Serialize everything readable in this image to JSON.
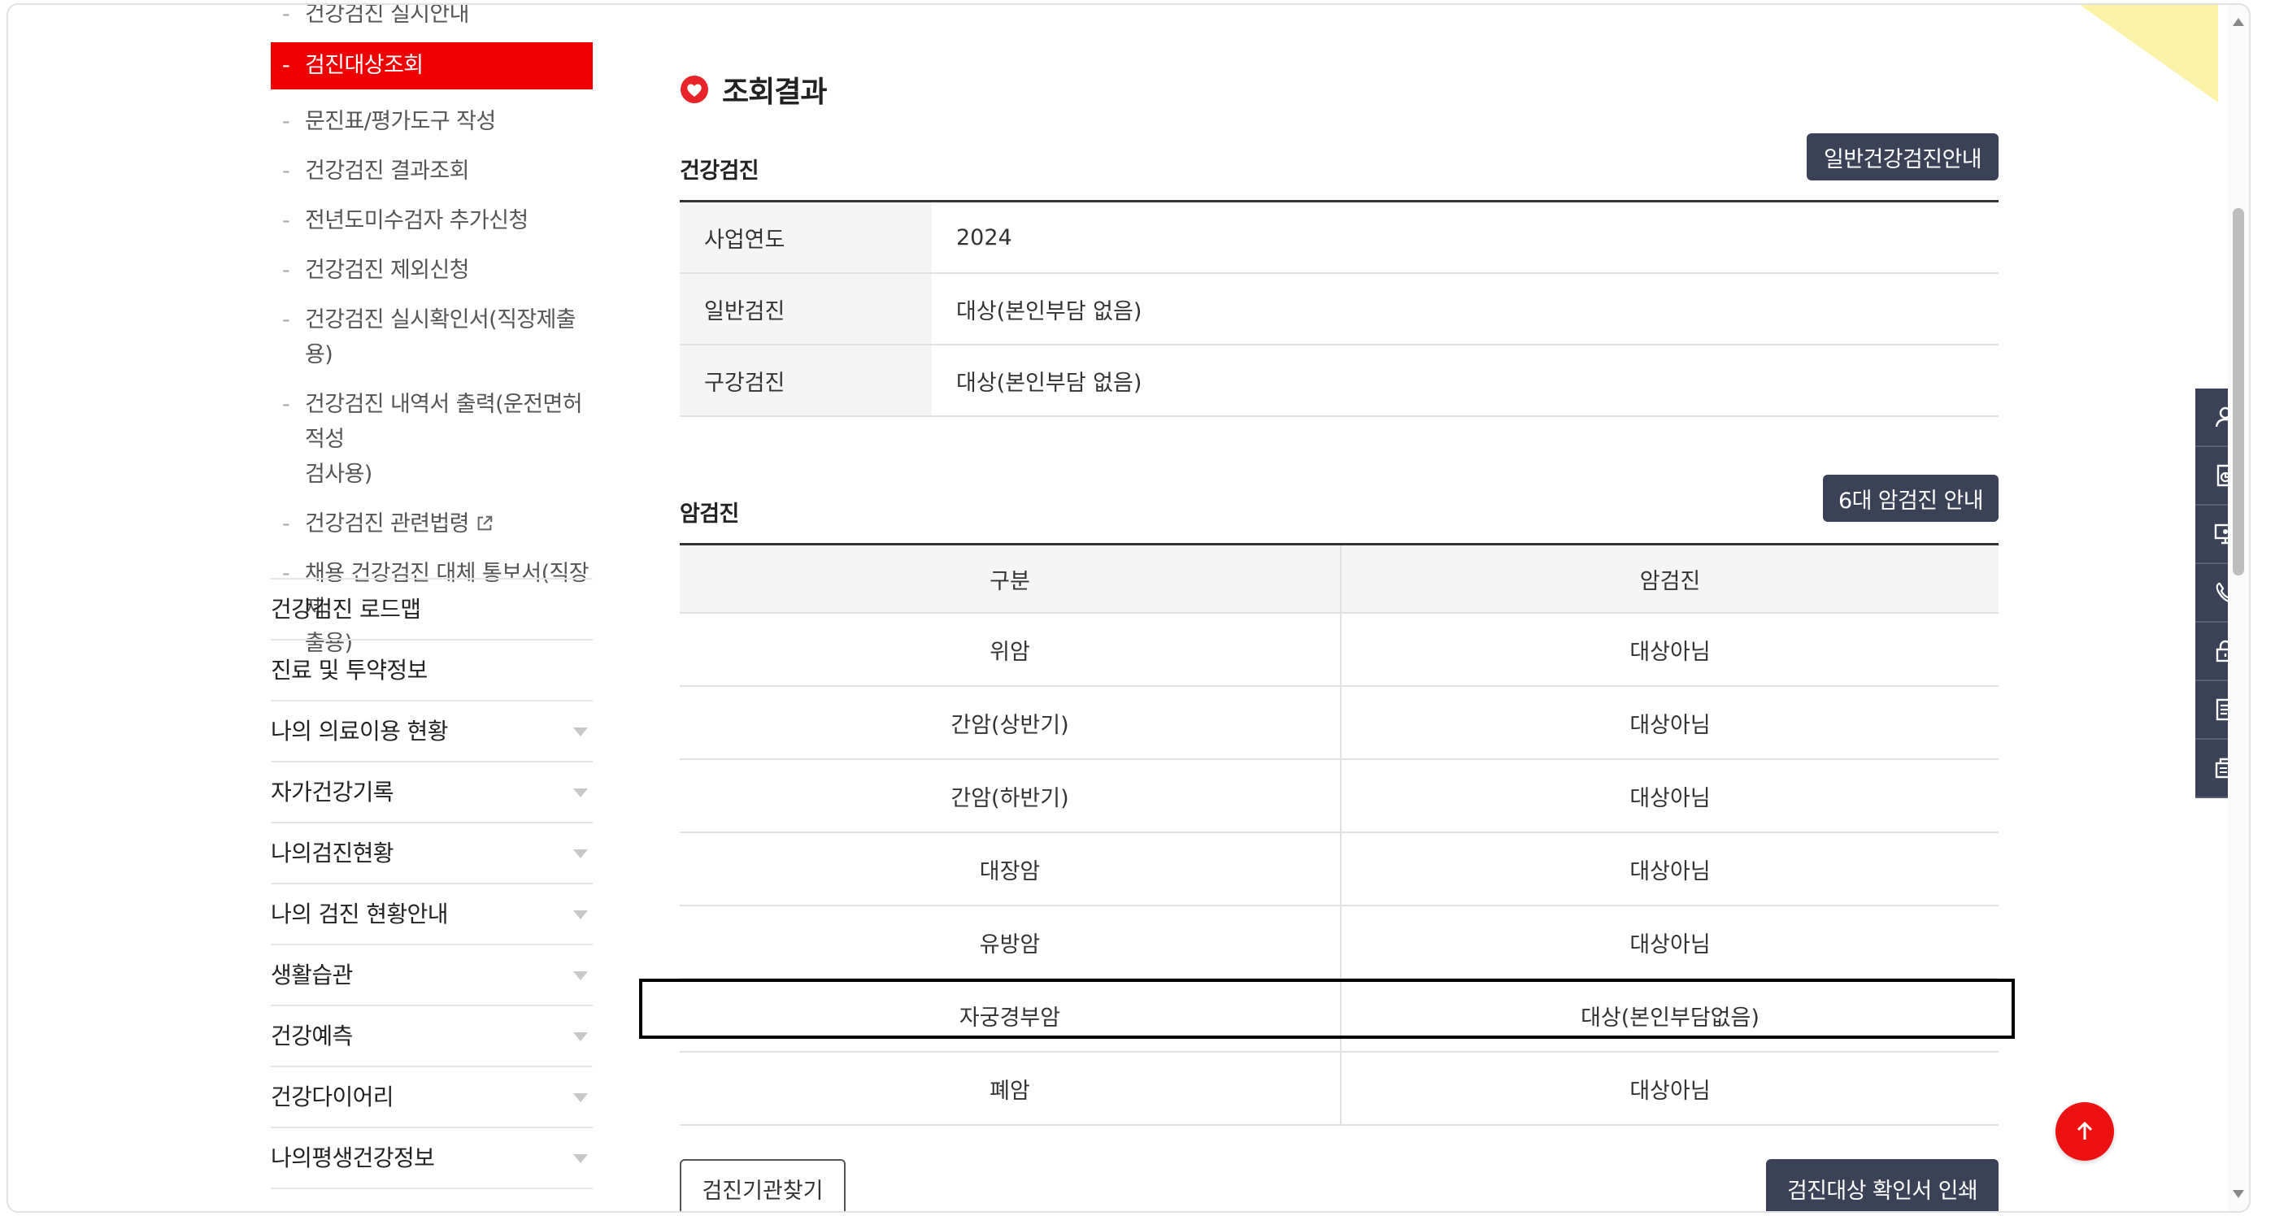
{
  "sidebar": {
    "sub_items": [
      {
        "label": "건강검진 실시안내",
        "active": false
      },
      {
        "label": "검진대상조회",
        "active": true
      },
      {
        "label": "문진표/평가도구 작성",
        "active": false
      },
      {
        "label": "건강검진 결과조회",
        "active": false
      },
      {
        "label": "전년도미수검자 추가신청",
        "active": false
      },
      {
        "label": "건강검진 제외신청",
        "active": false
      },
      {
        "label": "건강검진 실시확인서(직장제출용)",
        "active": false
      },
      {
        "label": "건강검진 내역서 출력(운전면허적성",
        "label2": "검사용)",
        "active": false
      },
      {
        "label": "건강검진 관련법령",
        "active": false,
        "external": true
      },
      {
        "label": "채용 건강검진 대체 통보서(직장제",
        "label2": "출용)",
        "active": false
      }
    ],
    "main_items": [
      {
        "label": "건강검진 로드맵",
        "expandable": false
      },
      {
        "label": "진료 및 투약정보",
        "expandable": false
      },
      {
        "label": "나의 의료이용 현황",
        "expandable": true
      },
      {
        "label": "자가건강기록",
        "expandable": true
      },
      {
        "label": "나의검진현황",
        "expandable": true
      },
      {
        "label": "나의 검진 현황안내",
        "expandable": true
      },
      {
        "label": "생활습관",
        "expandable": true
      },
      {
        "label": "건강예측",
        "expandable": true
      },
      {
        "label": "건강다이어리",
        "expandable": true
      },
      {
        "label": "나의평생건강정보",
        "expandable": true
      }
    ]
  },
  "main": {
    "title": "조회결과",
    "health_section": {
      "title": "건강검진",
      "button": "일반건강검진안내",
      "rows": [
        {
          "label": "사업연도",
          "value": "2024"
        },
        {
          "label": "일반검진",
          "value": "대상(본인부담 없음)"
        },
        {
          "label": "구강검진",
          "value": "대상(본인부담 없음)"
        }
      ]
    },
    "cancer_section": {
      "title": "암검진",
      "button": "6대 암검진 안내",
      "headers": [
        "구분",
        "암검진"
      ],
      "rows": [
        {
          "type": "위암",
          "status": "대상아님"
        },
        {
          "type": "간암(상반기)",
          "status": "대상아님"
        },
        {
          "type": "간암(하반기)",
          "status": "대상아님"
        },
        {
          "type": "대장암",
          "status": "대상아님"
        },
        {
          "type": "유방암",
          "status": "대상아님"
        },
        {
          "type": "자궁경부암",
          "status": "대상(본인부담없음)"
        },
        {
          "type": "폐암",
          "status": "대상아님"
        }
      ]
    },
    "find_button": "검진기관찾기",
    "print_button": "검진대상 확인서 인쇄"
  },
  "colors": {
    "accent": "#ee0000",
    "navy": "#3b4157",
    "corner": "#fdf3a8"
  },
  "quick_menu_icons": [
    "user-icon",
    "document-chart-icon",
    "monitor-icon",
    "phone-icon",
    "lock-icon",
    "list-icon",
    "copy-icon"
  ]
}
